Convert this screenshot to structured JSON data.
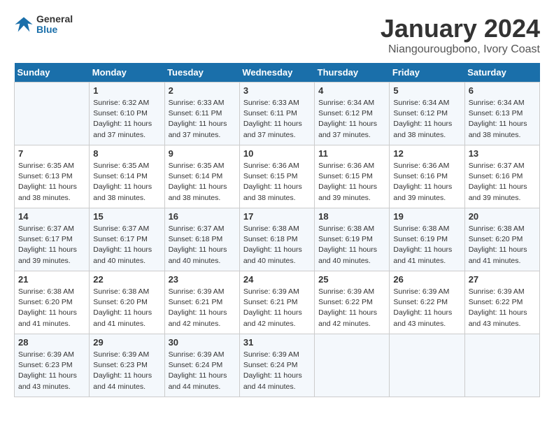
{
  "logo": {
    "general": "General",
    "blue": "Blue"
  },
  "title": "January 2024",
  "location": "Niangourougbono, Ivory Coast",
  "weekdays": [
    "Sunday",
    "Monday",
    "Tuesday",
    "Wednesday",
    "Thursday",
    "Friday",
    "Saturday"
  ],
  "weeks": [
    [
      {
        "day": "",
        "sunrise": "",
        "sunset": "",
        "daylight": ""
      },
      {
        "day": "1",
        "sunrise": "Sunrise: 6:32 AM",
        "sunset": "Sunset: 6:10 PM",
        "daylight": "Daylight: 11 hours and 37 minutes."
      },
      {
        "day": "2",
        "sunrise": "Sunrise: 6:33 AM",
        "sunset": "Sunset: 6:11 PM",
        "daylight": "Daylight: 11 hours and 37 minutes."
      },
      {
        "day": "3",
        "sunrise": "Sunrise: 6:33 AM",
        "sunset": "Sunset: 6:11 PM",
        "daylight": "Daylight: 11 hours and 37 minutes."
      },
      {
        "day": "4",
        "sunrise": "Sunrise: 6:34 AM",
        "sunset": "Sunset: 6:12 PM",
        "daylight": "Daylight: 11 hours and 37 minutes."
      },
      {
        "day": "5",
        "sunrise": "Sunrise: 6:34 AM",
        "sunset": "Sunset: 6:12 PM",
        "daylight": "Daylight: 11 hours and 38 minutes."
      },
      {
        "day": "6",
        "sunrise": "Sunrise: 6:34 AM",
        "sunset": "Sunset: 6:13 PM",
        "daylight": "Daylight: 11 hours and 38 minutes."
      }
    ],
    [
      {
        "day": "7",
        "sunrise": "Sunrise: 6:35 AM",
        "sunset": "Sunset: 6:13 PM",
        "daylight": "Daylight: 11 hours and 38 minutes."
      },
      {
        "day": "8",
        "sunrise": "Sunrise: 6:35 AM",
        "sunset": "Sunset: 6:14 PM",
        "daylight": "Daylight: 11 hours and 38 minutes."
      },
      {
        "day": "9",
        "sunrise": "Sunrise: 6:35 AM",
        "sunset": "Sunset: 6:14 PM",
        "daylight": "Daylight: 11 hours and 38 minutes."
      },
      {
        "day": "10",
        "sunrise": "Sunrise: 6:36 AM",
        "sunset": "Sunset: 6:15 PM",
        "daylight": "Daylight: 11 hours and 38 minutes."
      },
      {
        "day": "11",
        "sunrise": "Sunrise: 6:36 AM",
        "sunset": "Sunset: 6:15 PM",
        "daylight": "Daylight: 11 hours and 39 minutes."
      },
      {
        "day": "12",
        "sunrise": "Sunrise: 6:36 AM",
        "sunset": "Sunset: 6:16 PM",
        "daylight": "Daylight: 11 hours and 39 minutes."
      },
      {
        "day": "13",
        "sunrise": "Sunrise: 6:37 AM",
        "sunset": "Sunset: 6:16 PM",
        "daylight": "Daylight: 11 hours and 39 minutes."
      }
    ],
    [
      {
        "day": "14",
        "sunrise": "Sunrise: 6:37 AM",
        "sunset": "Sunset: 6:17 PM",
        "daylight": "Daylight: 11 hours and 39 minutes."
      },
      {
        "day": "15",
        "sunrise": "Sunrise: 6:37 AM",
        "sunset": "Sunset: 6:17 PM",
        "daylight": "Daylight: 11 hours and 40 minutes."
      },
      {
        "day": "16",
        "sunrise": "Sunrise: 6:37 AM",
        "sunset": "Sunset: 6:18 PM",
        "daylight": "Daylight: 11 hours and 40 minutes."
      },
      {
        "day": "17",
        "sunrise": "Sunrise: 6:38 AM",
        "sunset": "Sunset: 6:18 PM",
        "daylight": "Daylight: 11 hours and 40 minutes."
      },
      {
        "day": "18",
        "sunrise": "Sunrise: 6:38 AM",
        "sunset": "Sunset: 6:19 PM",
        "daylight": "Daylight: 11 hours and 40 minutes."
      },
      {
        "day": "19",
        "sunrise": "Sunrise: 6:38 AM",
        "sunset": "Sunset: 6:19 PM",
        "daylight": "Daylight: 11 hours and 41 minutes."
      },
      {
        "day": "20",
        "sunrise": "Sunrise: 6:38 AM",
        "sunset": "Sunset: 6:20 PM",
        "daylight": "Daylight: 11 hours and 41 minutes."
      }
    ],
    [
      {
        "day": "21",
        "sunrise": "Sunrise: 6:38 AM",
        "sunset": "Sunset: 6:20 PM",
        "daylight": "Daylight: 11 hours and 41 minutes."
      },
      {
        "day": "22",
        "sunrise": "Sunrise: 6:38 AM",
        "sunset": "Sunset: 6:20 PM",
        "daylight": "Daylight: 11 hours and 41 minutes."
      },
      {
        "day": "23",
        "sunrise": "Sunrise: 6:39 AM",
        "sunset": "Sunset: 6:21 PM",
        "daylight": "Daylight: 11 hours and 42 minutes."
      },
      {
        "day": "24",
        "sunrise": "Sunrise: 6:39 AM",
        "sunset": "Sunset: 6:21 PM",
        "daylight": "Daylight: 11 hours and 42 minutes."
      },
      {
        "day": "25",
        "sunrise": "Sunrise: 6:39 AM",
        "sunset": "Sunset: 6:22 PM",
        "daylight": "Daylight: 11 hours and 42 minutes."
      },
      {
        "day": "26",
        "sunrise": "Sunrise: 6:39 AM",
        "sunset": "Sunset: 6:22 PM",
        "daylight": "Daylight: 11 hours and 43 minutes."
      },
      {
        "day": "27",
        "sunrise": "Sunrise: 6:39 AM",
        "sunset": "Sunset: 6:22 PM",
        "daylight": "Daylight: 11 hours and 43 minutes."
      }
    ],
    [
      {
        "day": "28",
        "sunrise": "Sunrise: 6:39 AM",
        "sunset": "Sunset: 6:23 PM",
        "daylight": "Daylight: 11 hours and 43 minutes."
      },
      {
        "day": "29",
        "sunrise": "Sunrise: 6:39 AM",
        "sunset": "Sunset: 6:23 PM",
        "daylight": "Daylight: 11 hours and 44 minutes."
      },
      {
        "day": "30",
        "sunrise": "Sunrise: 6:39 AM",
        "sunset": "Sunset: 6:24 PM",
        "daylight": "Daylight: 11 hours and 44 minutes."
      },
      {
        "day": "31",
        "sunrise": "Sunrise: 6:39 AM",
        "sunset": "Sunset: 6:24 PM",
        "daylight": "Daylight: 11 hours and 44 minutes."
      },
      {
        "day": "",
        "sunrise": "",
        "sunset": "",
        "daylight": ""
      },
      {
        "day": "",
        "sunrise": "",
        "sunset": "",
        "daylight": ""
      },
      {
        "day": "",
        "sunrise": "",
        "sunset": "",
        "daylight": ""
      }
    ]
  ]
}
